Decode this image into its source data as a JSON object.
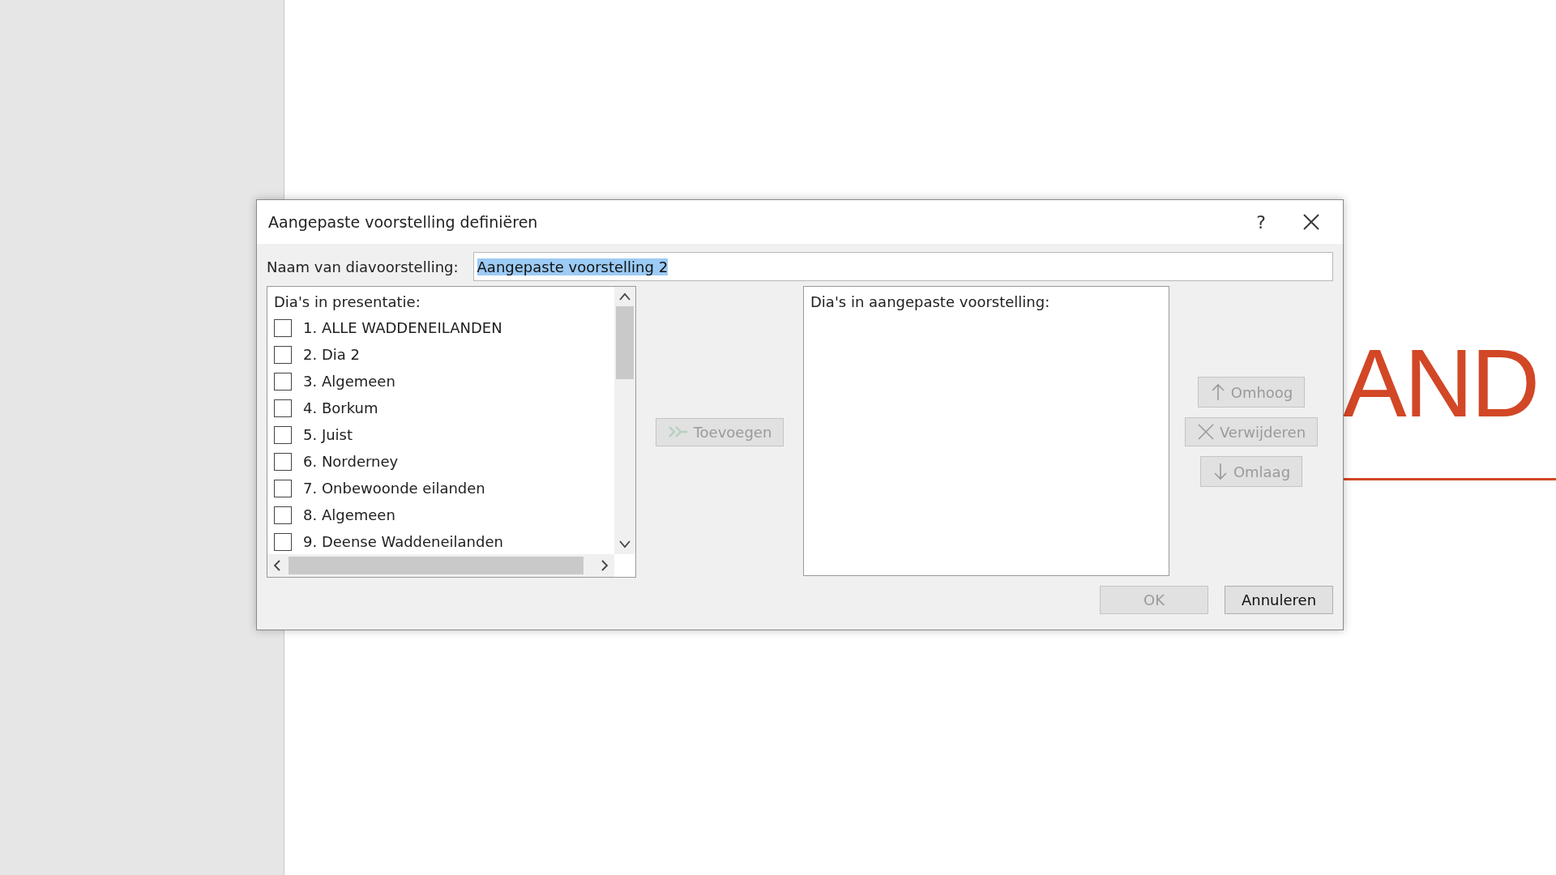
{
  "slide": {
    "title_fragment": "AND"
  },
  "dialog": {
    "title": "Aangepaste voorstelling definiëren",
    "help": "?",
    "name_field": {
      "label": "Naam van diavoorstelling:",
      "value": "Aangepaste voorstelling 2",
      "selected": true
    },
    "source_list": {
      "heading": "Dia's in presentatie:",
      "items": [
        {
          "label": "1. ALLE WADDENEILANDEN",
          "checked": false
        },
        {
          "label": "2. Dia 2",
          "checked": false
        },
        {
          "label": "3. Algemeen",
          "checked": false
        },
        {
          "label": "4. Borkum",
          "checked": false
        },
        {
          "label": "5. Juist",
          "checked": false
        },
        {
          "label": "6. Norderney",
          "checked": false
        },
        {
          "label": "7. Onbewoonde eilanden",
          "checked": false
        },
        {
          "label": "8. Algemeen",
          "checked": false
        },
        {
          "label": "9. Deense Waddeneilanden",
          "checked": false
        }
      ]
    },
    "add_button": {
      "label": "Toevoegen",
      "disabled": true
    },
    "target_list": {
      "heading": "Dia's in aangepaste voorstelling:"
    },
    "order_buttons": [
      {
        "kind": "up",
        "label": "Omhoog",
        "disabled": true
      },
      {
        "kind": "remove",
        "label": "Verwijderen",
        "disabled": true
      },
      {
        "kind": "down",
        "label": "Omlaag",
        "disabled": true
      }
    ],
    "footer_buttons": [
      {
        "label": "OK",
        "disabled": true
      },
      {
        "label": "Annuleren",
        "disabled": false
      }
    ]
  }
}
